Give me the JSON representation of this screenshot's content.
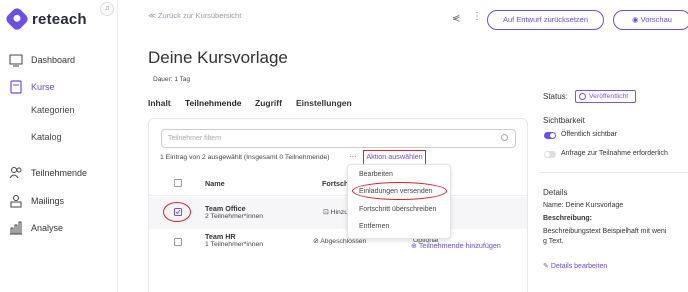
{
  "brand": {
    "name": "reteach",
    "accent": "#6c4ee8",
    "highlight": "#d9232a"
  },
  "sidebar": {
    "items": [
      {
        "label": "Dashboard",
        "icon": "dashboard-icon"
      },
      {
        "label": "Kurse",
        "icon": "courses-icon",
        "active": true
      },
      {
        "label": "Teilnehmende",
        "icon": "participants-icon"
      },
      {
        "label": "Mailings",
        "icon": "mailings-icon"
      },
      {
        "label": "Analyse",
        "icon": "analytics-icon"
      }
    ],
    "sub_items": [
      "Kategorien",
      "Katalog"
    ]
  },
  "header": {
    "back_link": "≪ Zurück zur Kursübersicht",
    "reset_label": "Auf Entwurf zurücksetzen",
    "preview_label": "Vorschau"
  },
  "course": {
    "title": "Deine Kursvorlage",
    "duration": "Dauer: 1 Tag"
  },
  "tabs": [
    "Inhalt",
    "Teilnehmende",
    "Zugriff",
    "Einstellungen"
  ],
  "participants": {
    "filter_placeholder": "Teilnehmer filtern",
    "selection_info": "1 Eintrag von 2 ausgewählt (Insgesamt 0 Teilnehmende)",
    "action_label": "Aktion auswählen",
    "columns": [
      "Name",
      "Fortsch"
    ],
    "rows": [
      {
        "name": "Team Office",
        "count": "2 Teilnehmer*innen",
        "progress": "Hinzu",
        "option": "",
        "checked": true
      },
      {
        "name": "Team HR",
        "count": "1 Teilnehmer*innen",
        "progress": "Abgeschlossen",
        "option": "Optional",
        "checked": false
      }
    ],
    "add_label": "Teilnehmende hinzufügen"
  },
  "action_menu": [
    "Bearbeiten",
    "Einladungen versenden",
    "Fortschritt überschreiben",
    "Entfernen"
  ],
  "right_panel": {
    "status_label": "Status:",
    "status_value": "Veröffentlicht",
    "visibility_title": "Sichtbarkeit",
    "toggle_public": "Öffentlich sichtbar",
    "toggle_request": "Anfrage zur Teilnahme erforderlich",
    "details_title": "Details",
    "name_line": "Name: Deine Kursvorlage",
    "description_label": "Beschreibung:",
    "description_text_1": "Beschreibungstext Beispielhaft mit weni",
    "description_text_2": "g Text.",
    "edit_details": "Details bearbeiten"
  }
}
